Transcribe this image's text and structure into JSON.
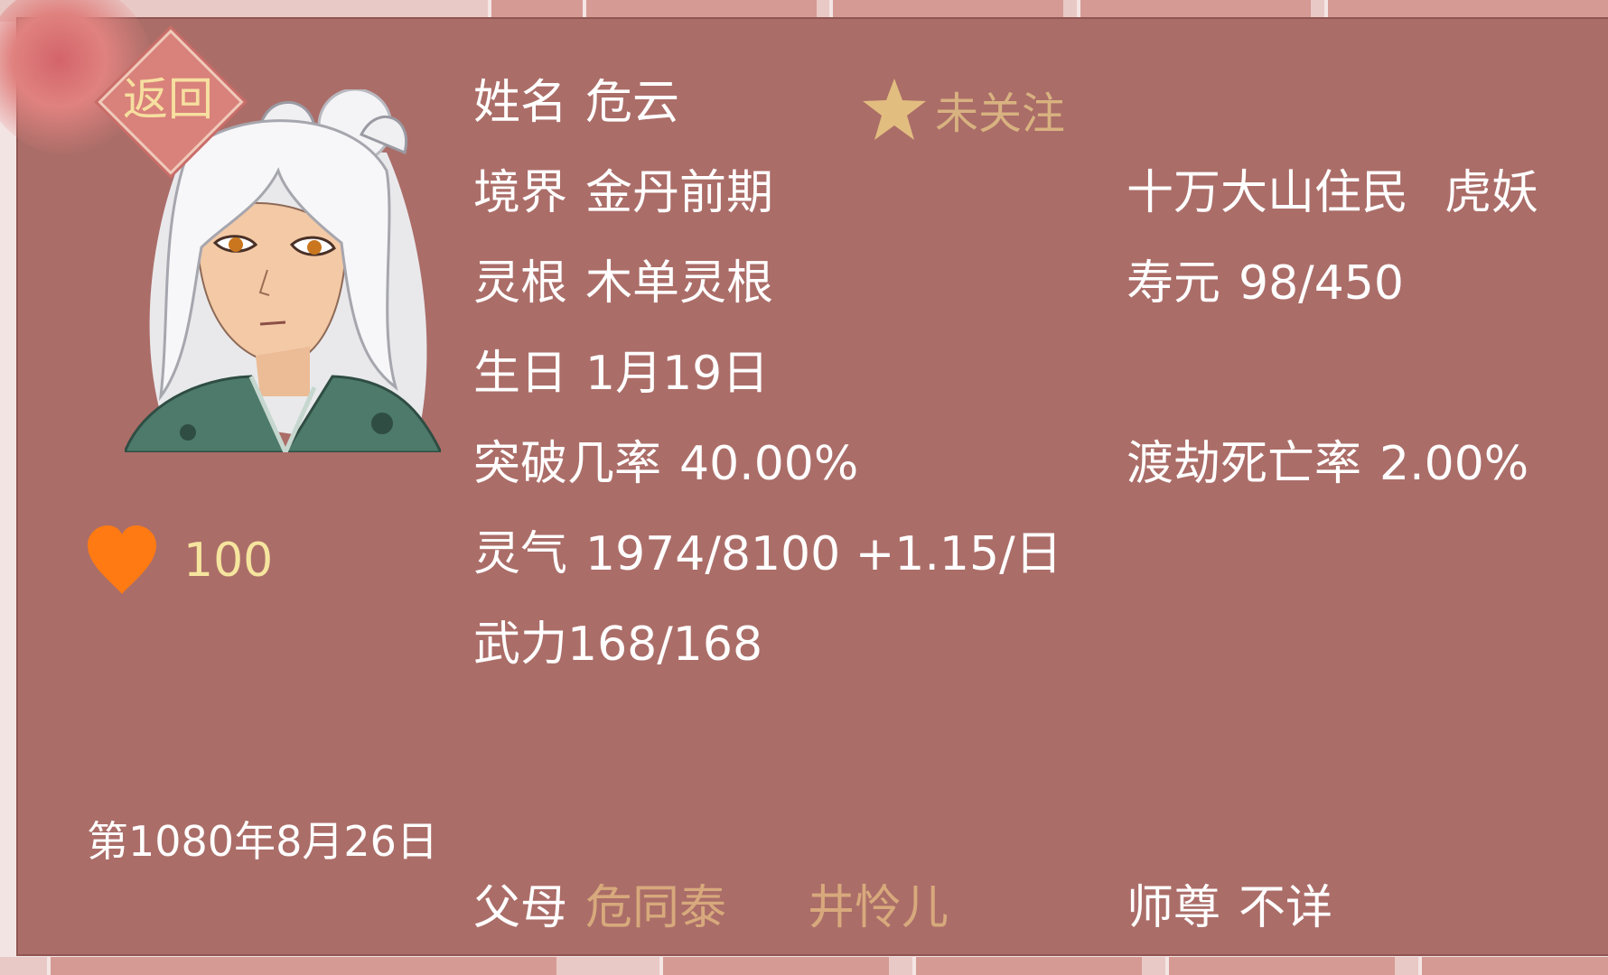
{
  "nav": {
    "back_label": "返回"
  },
  "character": {
    "name_label": "姓名",
    "name": "危云",
    "follow_label": "未关注",
    "realm_label": "境界",
    "realm": "金丹前期",
    "origin": "十万大山住民",
    "race": "虎妖",
    "root_label": "灵根",
    "root": "木单灵根",
    "lifespan_label": "寿元",
    "lifespan": "98/450",
    "birthday_label": "生日",
    "birthday": "1月19日",
    "breakthrough_label": "突破几率",
    "breakthrough": "40.00%",
    "tribulation_label": "渡劫死亡率",
    "tribulation": "2.00%",
    "qi_label": "灵气",
    "qi": "1974/8100 +1.15/日",
    "force_text": "武力168/168",
    "favor": "100",
    "date": "第1080年8月26日",
    "parents_label": "父母",
    "father": "危同泰",
    "mother": "井怜儿",
    "master_label": "师尊",
    "master": "不详"
  },
  "colors": {
    "panel": "#ab6d68",
    "highlight_text": "#f6e59e",
    "link_text": "#d7a97c",
    "heart": "#ff7a12",
    "star": "#e2bd80"
  },
  "icons": {
    "favor": "heart-icon",
    "follow": "star-icon"
  }
}
